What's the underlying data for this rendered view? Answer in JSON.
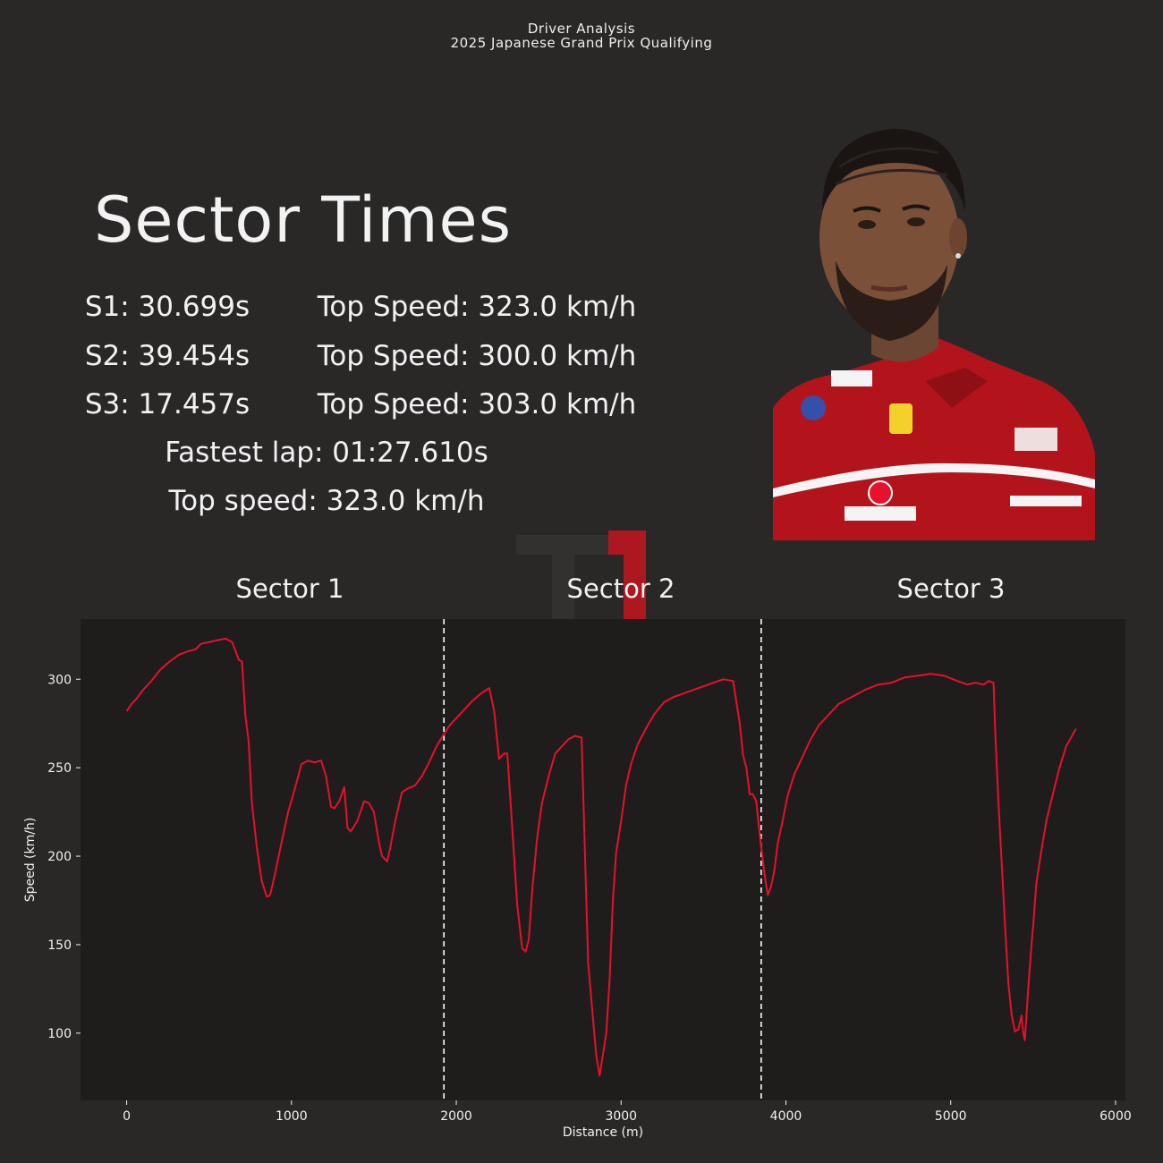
{
  "header": {
    "line1": "Driver Analysis",
    "line2": "2025 Japanese Grand Prix Qualifying"
  },
  "summary": {
    "heading": "Sector Times",
    "rows": [
      {
        "sector": "S1: 30.699s",
        "top_speed": "Top Speed: 323.0 km/h"
      },
      {
        "sector": "S2: 39.454s",
        "top_speed": "Top Speed: 300.0 km/h"
      },
      {
        "sector": "S3: 17.457s",
        "top_speed": "Top Speed: 303.0 km/h"
      }
    ],
    "fastest_lap": "Fastest lap: 01:27.610s",
    "top_speed": "Top speed: 323.0 km/h"
  },
  "colors": {
    "background": "#2a2727",
    "plot_background": "#1e1d1c",
    "line": "#e8102a",
    "text": "#f2f2f2"
  },
  "chart_data": {
    "type": "line",
    "xlabel": "Distance (m)",
    "ylabel": "Speed (km/h)",
    "xlim": [
      -280,
      6060
    ],
    "ylim": [
      62,
      334
    ],
    "xticks": [
      0,
      1000,
      2000,
      3000,
      4000,
      5000,
      6000
    ],
    "yticks": [
      100,
      150,
      200,
      250,
      300
    ],
    "grid": false,
    "sector_titles": [
      "Sector 1",
      "Sector 2",
      "Sector 3"
    ],
    "sector_boundaries": [
      1925,
      3850
    ],
    "series": [
      {
        "color": "#e8102a",
        "x": [
          0,
          30,
          60,
          100,
          150,
          200,
          260,
          320,
          380,
          420,
          450,
          500,
          550,
          600,
          640,
          680,
          700,
          720,
          740,
          760,
          790,
          820,
          850,
          870,
          900,
          940,
          980,
          1020,
          1060,
          1100,
          1140,
          1180,
          1210,
          1240,
          1260,
          1290,
          1320,
          1340,
          1360,
          1400,
          1440,
          1470,
          1500,
          1530,
          1550,
          1580,
          1600,
          1630,
          1670,
          1700,
          1750,
          1790,
          1830,
          1880,
          1925,
          1960,
          2000,
          2050,
          2100,
          2150,
          2200,
          2230,
          2260,
          2280,
          2290,
          2310,
          2340,
          2370,
          2400,
          2420,
          2440,
          2460,
          2490,
          2520,
          2560,
          2600,
          2640,
          2680,
          2720,
          2760,
          2800,
          2840,
          2850,
          2870,
          2890,
          2910,
          2930,
          2950,
          2970,
          3000,
          3030,
          3060,
          3100,
          3150,
          3200,
          3260,
          3320,
          3380,
          3440,
          3500,
          3560,
          3620,
          3680,
          3720,
          3740,
          3760,
          3780,
          3800,
          3820,
          3850,
          3870,
          3890,
          3910,
          3930,
          3950,
          3980,
          4010,
          4050,
          4100,
          4150,
          4200,
          4260,
          4320,
          4400,
          4480,
          4560,
          4640,
          4720,
          4800,
          4880,
          4960,
          5040,
          5100,
          5150,
          5200,
          5230,
          5260,
          5270,
          5290,
          5310,
          5330,
          5350,
          5370,
          5390,
          5410,
          5430,
          5440,
          5450,
          5470,
          5490,
          5500,
          5520,
          5550,
          5580,
          5620,
          5660,
          5700,
          5730,
          5760
        ],
        "y": [
          282,
          286,
          289,
          294,
          299,
          305,
          310,
          314,
          316,
          317,
          320,
          321,
          322,
          323,
          321,
          311,
          310,
          280,
          265,
          230,
          205,
          186,
          177,
          178,
          190,
          208,
          225,
          238,
          252,
          254,
          253,
          254,
          245,
          228,
          227,
          231,
          239,
          216,
          214,
          220,
          231,
          230,
          225,
          208,
          200,
          197,
          205,
          220,
          236,
          238,
          240,
          245,
          252,
          262,
          269,
          274,
          278,
          283,
          288,
          292,
          295,
          282,
          255,
          257,
          258,
          258,
          215,
          172,
          148,
          146,
          153,
          180,
          210,
          230,
          245,
          258,
          262,
          266,
          268,
          267,
          140,
          97,
          87,
          76,
          88,
          100,
          130,
          175,
          202,
          220,
          240,
          252,
          263,
          272,
          280,
          287,
          290,
          292,
          294,
          296,
          298,
          300,
          299,
          275,
          257,
          250,
          235,
          235,
          231,
          205,
          190,
          178,
          183,
          192,
          207,
          220,
          234,
          246,
          256,
          266,
          274,
          280,
          286,
          290,
          294,
          297,
          298,
          301,
          302,
          303,
          302,
          299,
          297,
          298,
          297,
          299,
          298,
          270,
          230,
          195,
          160,
          128,
          110,
          101,
          102,
          110,
          100,
          96,
          125,
          150,
          160,
          185,
          203,
          220,
          235,
          250,
          262,
          267,
          272
        ]
      }
    ]
  }
}
